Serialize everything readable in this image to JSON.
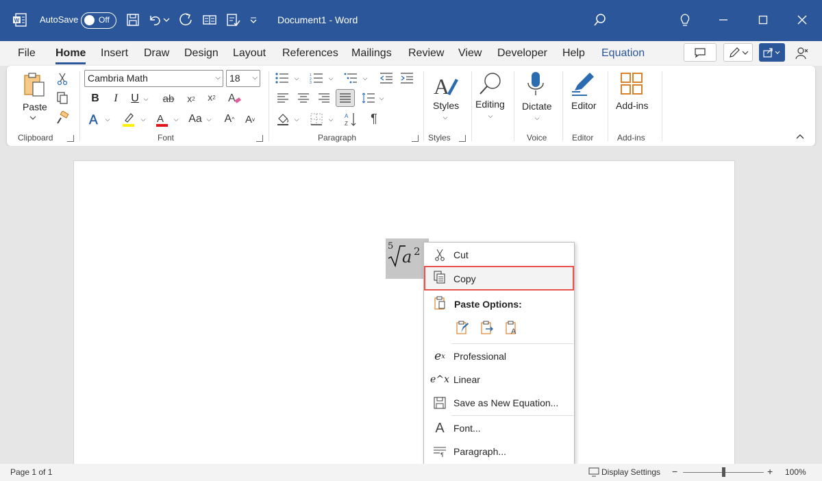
{
  "titlebar": {
    "autosave_label": "AutoSave",
    "autosave_state": "Off",
    "document_title": "Document1  -  Word"
  },
  "tabs": [
    "File",
    "Home",
    "Insert",
    "Draw",
    "Design",
    "Layout",
    "References",
    "Mailings",
    "Review",
    "View",
    "Developer",
    "Help",
    "Equation"
  ],
  "active_tab": "Home",
  "ribbon": {
    "clipboard": {
      "paste_label": "Paste",
      "group_label": "Clipboard"
    },
    "font": {
      "font_name": "Cambria Math",
      "font_size": "18",
      "group_label": "Font"
    },
    "paragraph": {
      "group_label": "Paragraph"
    },
    "styles": {
      "label": "Styles",
      "group_label": "Styles"
    },
    "editing": {
      "label": "Editing"
    },
    "voice": {
      "label": "Dictate",
      "group_label": "Voice"
    },
    "editor": {
      "label": "Editor",
      "group_label": "Editor"
    },
    "addins": {
      "label": "Add-ins",
      "group_label": "Add-ins"
    }
  },
  "equation": {
    "index": "5",
    "base": "a",
    "exponent": "2"
  },
  "context_menu": {
    "cut": "Cut",
    "copy": "Copy",
    "paste_options": "Paste Options:",
    "professional": "Professional",
    "linear": "Linear",
    "save_as_new_equation": "Save as New Equation...",
    "font": "Font...",
    "paragraph": "Paragraph..."
  },
  "statusbar": {
    "page": "Page 1 of 1",
    "display_settings": "Display Settings",
    "zoom": "100%"
  },
  "colors": {
    "brand": "#2b579a",
    "highlight_border": "#e8524a",
    "icon_orange": "#d9822b",
    "icon_blue": "#2b6cb0"
  }
}
